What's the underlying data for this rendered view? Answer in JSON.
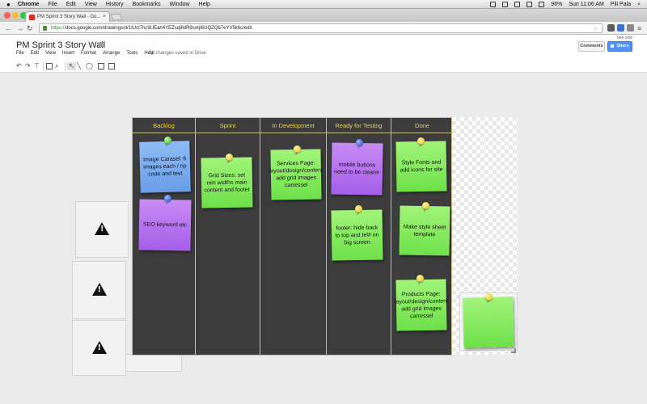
{
  "os_menubar": {
    "apple": "",
    "menus": [
      "Chrome",
      "File",
      "Edit",
      "View",
      "History",
      "Bookmarks",
      "Window",
      "Help"
    ],
    "battery": "96%",
    "clock": "Sun 11:06 AM",
    "user": "Pili Pala"
  },
  "browser": {
    "tab_title": "PM Sprint 3 Story Wall - Go...",
    "url_scheme": "https://",
    "url_rest": "docs.google.com/drawings/d/1IUct7hc9UEah4YEZsq9ldR9sotjI6UQZQ67eYV5k6c/edit"
  },
  "doc": {
    "title": "PM Sprint 3 Story Wall",
    "menus": [
      "File",
      "Edit",
      "View",
      "Insert",
      "Format",
      "Arrange",
      "Tools",
      "Help"
    ],
    "save_status": "All changes saved in Drive",
    "user": "ben cole",
    "comments_label": "Comments",
    "share_label": "Share"
  },
  "board": {
    "columns": [
      "Backlog",
      "Sprint",
      "In Development",
      "Ready for Testing",
      "Done"
    ],
    "notes": [
      {
        "column": "Backlog",
        "color": "blue",
        "text": "Image Carasel: 6 images each / rip code and test"
      },
      {
        "column": "Backlog",
        "color": "purple",
        "text": "SEO keyword etc"
      },
      {
        "column": "Sprint",
        "color": "green",
        "text": "Grid Sizes: set min widths main content and footer"
      },
      {
        "column": "In Development",
        "color": "green",
        "text": "Services Page: layout/design/content add grid images carressel"
      },
      {
        "column": "Ready for Testing",
        "color": "purple",
        "text": "mobile buttons need to be clearer"
      },
      {
        "column": "Ready for Testing",
        "color": "green",
        "text": "footer: hide back to top and tel# on big screen"
      },
      {
        "column": "Done",
        "color": "green",
        "text": "Style Fonts and add icons for site"
      },
      {
        "column": "Done",
        "color": "green",
        "text": "Make style sheet template"
      },
      {
        "column": "Done",
        "color": "green",
        "text": "Products Page: layout/design/content add grid images carressel"
      }
    ]
  },
  "colors": {
    "board_bg": "#3c3c3c",
    "header_text": "#f2d23a",
    "share_blue": "#4d90fe"
  }
}
